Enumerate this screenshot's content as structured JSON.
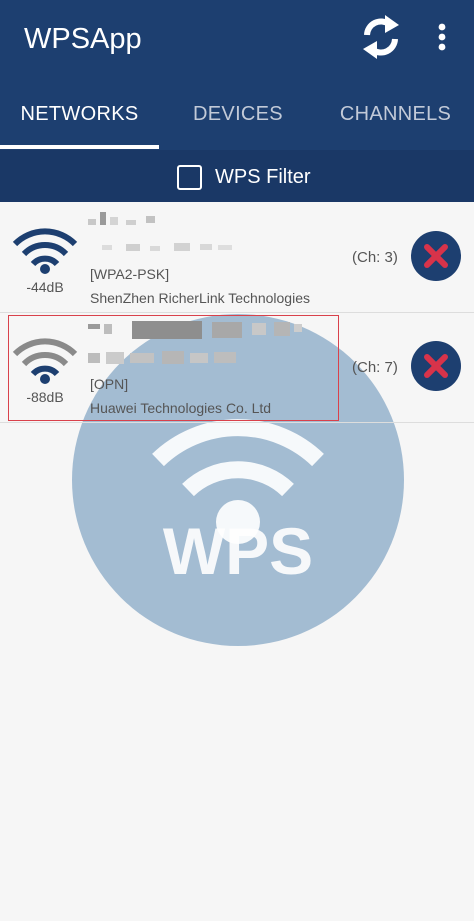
{
  "app": {
    "title": "WPSApp"
  },
  "toolbar": {
    "refresh_icon": "refresh-icon",
    "menu_icon": "overflow-menu-icon"
  },
  "tabs": [
    {
      "label": "NETWORKS",
      "active": true
    },
    {
      "label": "DEVICES",
      "active": false
    },
    {
      "label": "CHANNELS",
      "active": false
    }
  ],
  "filter": {
    "label": "WPS Filter",
    "checked": false
  },
  "watermark": {
    "text": "WPS"
  },
  "networks": [
    {
      "signal": "-44dB",
      "security": "[WPA2-PSK]",
      "vendor": "ShenZhen RicherLink Technologies",
      "channel": "(Ch: 3)",
      "icon_color": "#1d3f70"
    },
    {
      "signal": "-88dB",
      "security": "[OPN]",
      "vendor": "Huawei Technologies Co. Ltd",
      "channel": "(Ch: 7)",
      "icon_color": "#8a8a8a"
    }
  ],
  "colors": {
    "primary": "#1d3f70",
    "delete_x": "#d8334a",
    "highlight": "#d9414b"
  }
}
